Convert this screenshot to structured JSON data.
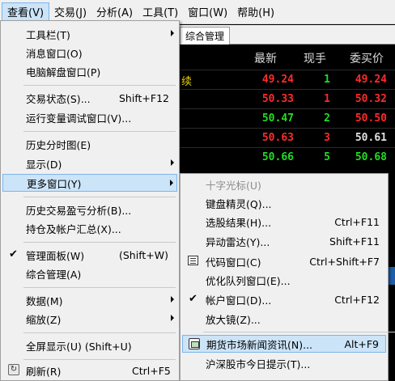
{
  "menubar": {
    "items": [
      "查看(V)",
      "交易(J)",
      "分析(A)",
      "工具(T)",
      "窗口(W)",
      "帮助(H)"
    ]
  },
  "background": {
    "tab_label": "综合管理",
    "headers": [
      "最新",
      "现手",
      "委买价"
    ],
    "partial_label": "续",
    "rows": [
      {
        "last": "49.24",
        "vol": "1",
        "bid": "49.24",
        "last_color": "#ff2a2a",
        "vol_color": "#22dd22",
        "bid_color": "#ff2a2a"
      },
      {
        "last": "50.33",
        "vol": "1",
        "bid": "50.32",
        "last_color": "#ff2a2a",
        "vol_color": "#ff2a2a",
        "bid_color": "#ff2a2a"
      },
      {
        "last": "50.47",
        "vol": "2",
        "bid": "50.50",
        "last_color": "#22dd22",
        "vol_color": "#22dd22",
        "bid_color": "#ff2a2a"
      },
      {
        "last": "50.63",
        "vol": "3",
        "bid": "50.61",
        "last_color": "#ff2a2a",
        "vol_color": "#ff2a2a",
        "bid_color": "#e0e0e0"
      },
      {
        "last": "50.66",
        "vol": "5",
        "bid": "50.68",
        "last_color": "#22dd22",
        "vol_color": "#22dd22",
        "bid_color": "#22dd22"
      }
    ]
  },
  "view_menu": {
    "toolbar": "工具栏(T)",
    "message_window": "消息窗口(O)",
    "puzzle_window": "电脑解盘窗口(P)",
    "trade_status": "交易状态(S)...",
    "trade_status_shortcut": "Shift+F12",
    "debug_window": "运行变量调试窗口(V)...",
    "history_tick": "历史分时图(E)",
    "display": "显示(D)",
    "more_windows": "更多窗口(Y)",
    "history_pnl": "历史交易盈亏分析(B)...",
    "positions_summary": "持仓及帐户汇总(X)...",
    "admin_panel": "管理面板(W)",
    "admin_panel_shortcut": "(Shift+W)",
    "overall_management": "综合管理(A)",
    "data": "数据(M)",
    "zoom": "缩放(Z)",
    "fullscreen": "全屏显示(U) (Shift+U)",
    "refresh": "刷新(R)",
    "refresh_shortcut": "Ctrl+F5"
  },
  "more_submenu": {
    "crosshair": "十字光标(U)",
    "keyboard_wizard": "键盘精灵(Q)...",
    "stock_results": "选股结果(H)...",
    "stock_results_shortcut": "Ctrl+F11",
    "radar": "异动雷达(Y)...",
    "radar_shortcut": "Shift+F11",
    "code_window": "代码窗口(C)",
    "code_window_shortcut": "Ctrl+Shift+F7",
    "queue_window": "优化队列窗口(E)...",
    "account_window": "帐户窗口(D)...",
    "account_window_shortcut": "Ctrl+F12",
    "magnifier": "放大镜(Z)...",
    "futures_news": "期货市场新闻资讯(N)...",
    "futures_news_shortcut": "Alt+F9",
    "sh_sz_tips": "沪深股市今日提示(T)..."
  }
}
